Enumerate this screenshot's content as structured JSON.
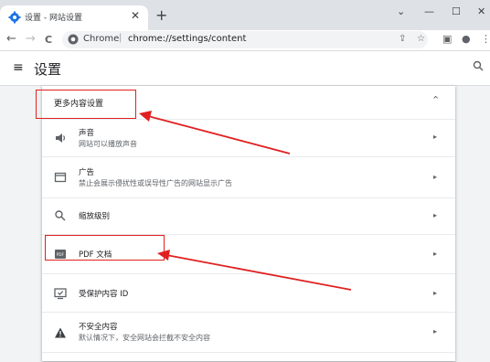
{
  "browser": {
    "tab_title": "设置 - 网站设置",
    "tab_close": "✕",
    "new_tab": "+",
    "window_controls": {
      "minimize": "⌄",
      "restore": "—",
      "maximize": "☐",
      "close": "✕"
    },
    "nav": {
      "back": "←",
      "forward": "→",
      "reload": "C"
    },
    "omnibox": {
      "site_label": "Chrome",
      "separator": "|",
      "url": "chrome://settings/content"
    },
    "toolbar_icons": [
      "share-icon",
      "star-icon",
      "side-panel-icon",
      "profile-icon",
      "menu-dots-icon"
    ]
  },
  "settings": {
    "menu_glyph": "≡",
    "title": "设置"
  },
  "section": {
    "title": "更多内容设置",
    "caret": "⌃",
    "items": [
      {
        "icon": "speaker-icon",
        "title": "声音",
        "subtitle": "网站可以播放声音"
      },
      {
        "icon": "ad-window-icon",
        "title": "广告",
        "subtitle": "禁止会展示侵扰性或误导性广告的网站显示广告"
      },
      {
        "icon": "zoom-icon",
        "title": "缩放级别",
        "subtitle": ""
      },
      {
        "icon": "pdf-icon",
        "title": "PDF 文档",
        "subtitle": ""
      },
      {
        "icon": "protected-content-icon",
        "title": "受保护内容 ID",
        "subtitle": ""
      },
      {
        "icon": "warning-icon",
        "title": "不安全内容",
        "subtitle": "默认情况下，安全网站会拦截不安全内容"
      }
    ],
    "chevron": "▸"
  },
  "colors": {
    "annotation": "#e02020",
    "accent": "#1a73e8"
  }
}
